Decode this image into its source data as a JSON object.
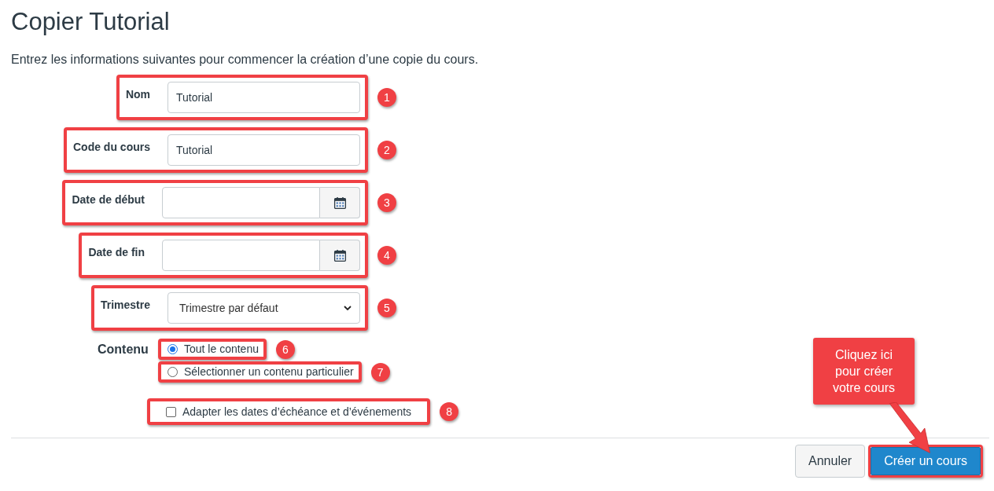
{
  "page_title": "Copier Tutorial",
  "intro": "Entrez les informations suivantes pour commencer la création d’une copie du cours.",
  "fields": [
    {
      "kind": "text",
      "label": "Nom",
      "value": "Tutorial",
      "marker": "1"
    },
    {
      "kind": "text",
      "label": "Code du cours",
      "value": "Tutorial",
      "marker": "2"
    },
    {
      "kind": "date",
      "label": "Date de début",
      "marker": "3"
    },
    {
      "kind": "date",
      "label": "Date de fin",
      "marker": "4"
    },
    {
      "kind": "select",
      "label": "Trimestre",
      "value": "Trimestre par défaut",
      "marker": "5"
    }
  ],
  "content": {
    "label": "Contenu",
    "options": [
      {
        "label": "Tout le contenu",
        "selected": true,
        "marker": "6"
      },
      {
        "label": "Sélectionner un contenu particulier",
        "selected": false,
        "marker": "7"
      }
    ]
  },
  "adjust_dates": {
    "label": "Adapter les dates d’échéance et d’événements",
    "checked": false,
    "marker": "8"
  },
  "buttons": [
    {
      "kind": "secondary",
      "label": "Annuler",
      "highlighted": false
    },
    {
      "kind": "primary",
      "label": "Créer un cours",
      "highlighted": true
    }
  ],
  "callout": "Cliquez ici pour créer votre cours"
}
